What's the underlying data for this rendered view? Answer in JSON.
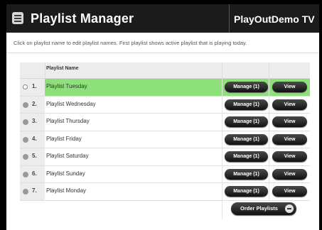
{
  "header": {
    "title": "Playlist Manager",
    "brand": "PlayOutDemo TV"
  },
  "instructions": "Click on playlist name to edit playlist names. First playlist shows active playlist that is playing today.",
  "table": {
    "column_header": "Playlist Name",
    "rows": [
      {
        "index": "1.",
        "name": "Playlist Tuesday",
        "manage": "Manage (1)",
        "view": "View",
        "active": true
      },
      {
        "index": "2.",
        "name": "Playlist Wednesday",
        "manage": "Manage (1)",
        "view": "View"
      },
      {
        "index": "3.",
        "name": "Playlist Thursday",
        "manage": "Manage (1)",
        "view": "View"
      },
      {
        "index": "4.",
        "name": "Playlist Friday",
        "manage": "Manage (1)",
        "view": "View"
      },
      {
        "index": "5.",
        "name": "Playlist Saturday",
        "manage": "Manage (1)",
        "view": "View"
      },
      {
        "index": "6.",
        "name": "Playlist Sunday",
        "manage": "Manage (1)",
        "view": "View"
      },
      {
        "index": "7.",
        "name": "Playlist Monday",
        "manage": "Manage (1)",
        "view": "View"
      }
    ]
  },
  "order_button": "Order Playlists",
  "colors": {
    "header_bg": "#1b1b1b",
    "active_row": "#8ee07a",
    "button": "#222222"
  }
}
